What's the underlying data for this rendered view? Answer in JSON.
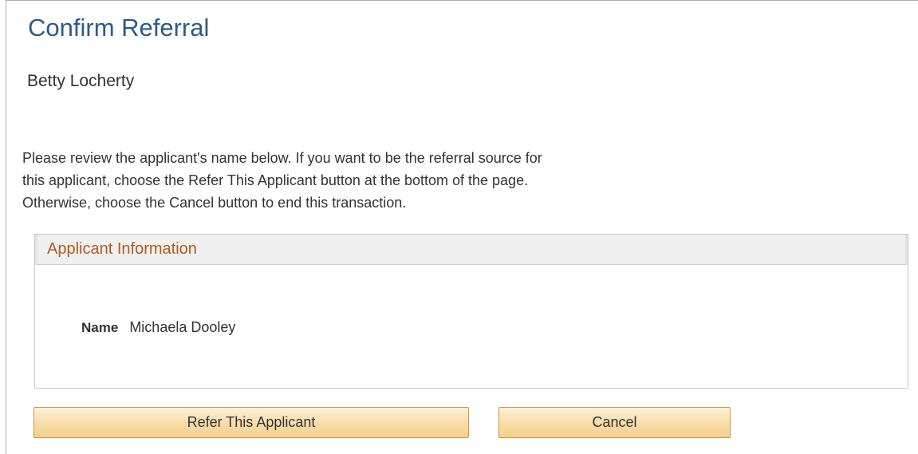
{
  "page": {
    "title": "Confirm Referral",
    "person_name": "Betty Locherty"
  },
  "instructions": {
    "line1": "Please review the applicant's name below. If you want to be the referral source for",
    "line2": "this applicant, choose the Refer This Applicant button at the bottom of the page.",
    "line3": "Otherwise, choose the Cancel button to end this transaction."
  },
  "applicant_info": {
    "header": "Applicant Information",
    "name_label": "Name",
    "name_value": "Michaela Dooley"
  },
  "actions": {
    "refer_label": "Refer This Applicant",
    "cancel_label": "Cancel"
  },
  "colors": {
    "title": "#2d5a8a",
    "group_header_text": "#b25a1e",
    "button_fill": "#f8dca7",
    "button_border": "#c8974e"
  }
}
